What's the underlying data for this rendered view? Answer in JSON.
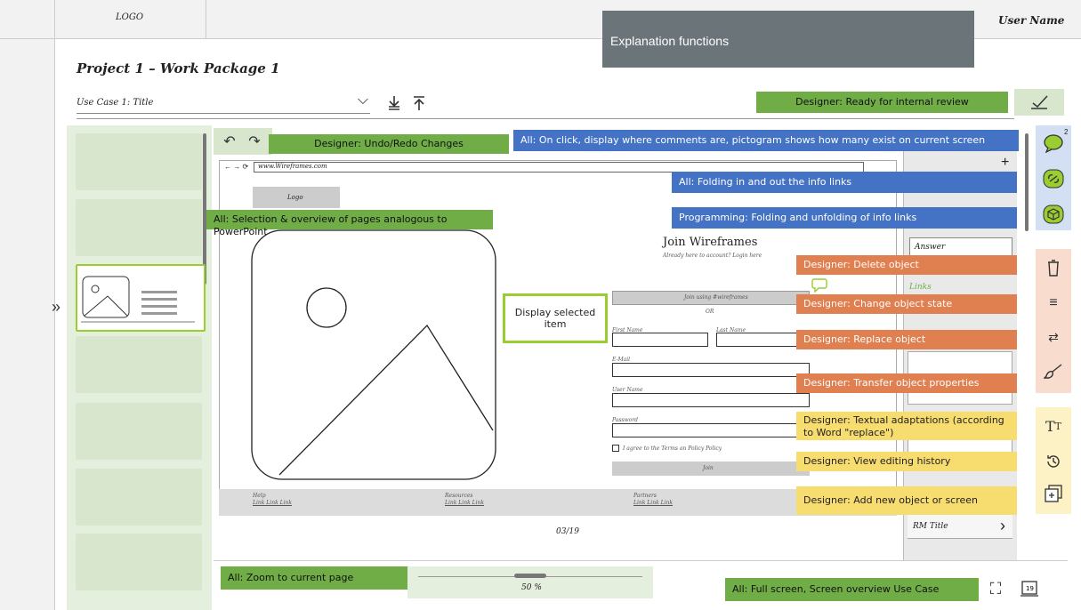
{
  "header": {
    "logo": "LOGO",
    "user_name": "User Name",
    "explanation_box": "Explanation functions"
  },
  "project": {
    "title": "Project 1 – Work Package 1"
  },
  "usecase": {
    "selected": "Use Case 1: Title"
  },
  "annotations": {
    "ready_review": "Designer: Ready for internal review",
    "undo_redo": "Designer: Undo/Redo Changes",
    "comments": "All: On click, display where comments are, pictogram shows how many exist on current screen",
    "folding": "All: Folding in and out the info links",
    "selection": "All: Selection & overview of pages analogous to PowerPoint",
    "programming": "Programming: Folding and unfolding of info links",
    "delete": "Designer: Delete object",
    "change_state": "Designer: Change object state",
    "replace": "Designer: Replace object",
    "transfer": "Designer: Transfer object properties",
    "textual": "Designer: Textual adaptations (according to Word \"replace\")",
    "history": "Designer: View editing history",
    "add_new": "Designer: Add new object or screen",
    "display_selected": "Display selected item",
    "zoom_current": "All: Zoom to current page",
    "fullscreen": "All: Full screen, Screen overview Use Case"
  },
  "canvas": {
    "url": "www.Wireframes.com",
    "logo": "Logo",
    "join_title": "Join Wireframes",
    "join_sub": "Already here to account? Login here",
    "join_using": "Join using #wireframes",
    "or": "OR",
    "first_name": "First Name",
    "last_name": "Last Name",
    "email": "E-Mail",
    "user_name": "User Name",
    "password": "Password",
    "agree": "I agree to the Terms an Policy Policy",
    "join_btn": "Join",
    "footer_cols": [
      "Help",
      "Resources",
      "Partners"
    ],
    "footer_links": "Link Link Link",
    "page_counter": "03/19"
  },
  "right_panel": {
    "answer": "Answer",
    "links": "Links",
    "rm_title": "RM Title",
    "plus": "+",
    "comment_count": "2"
  },
  "zoom": {
    "value": "50 %"
  },
  "icons": {
    "comment": "speech-bubble-icon",
    "link": "chain-link-icon",
    "cube": "cube-icon",
    "delete": "trash-icon",
    "state": "list-icon",
    "replace": "swap-arrows-icon",
    "transfer": "brush-icon",
    "text": "text-size-icon",
    "history": "history-icon",
    "add": "add-square-icon"
  },
  "colors": {
    "green": "#70ad47",
    "blue": "#4472c4",
    "orange": "#e07f4f",
    "yellow": "#f7dc6f",
    "gray_box": "#6b7479"
  }
}
